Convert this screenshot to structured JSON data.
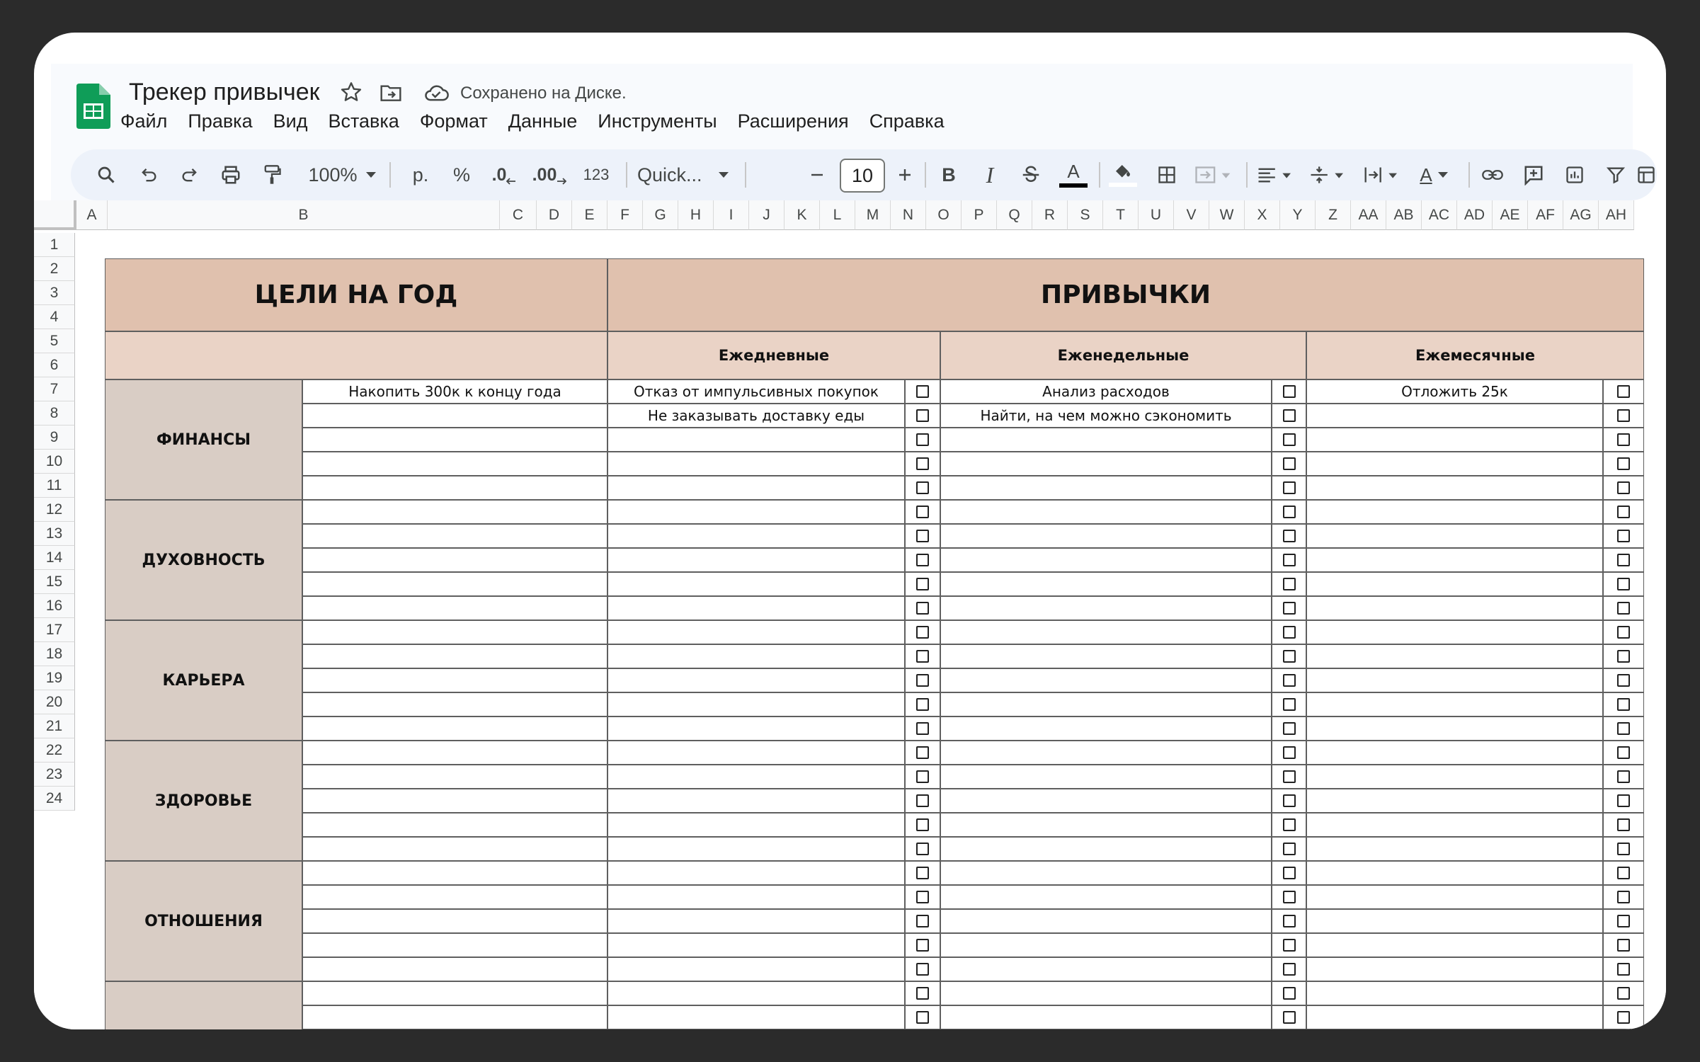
{
  "app": {
    "title": "Трекер привычек",
    "save_status": "Сохранено на Диске.",
    "menu": [
      "Файл",
      "Правка",
      "Вид",
      "Вставка",
      "Формат",
      "Данные",
      "Инструменты",
      "Расширения",
      "Справка"
    ]
  },
  "toolbar": {
    "zoom": "100%",
    "currency": "р.",
    "percent": "%",
    "decrease_decimal": ".0",
    "increase_decimal": ".00",
    "number_format": "123",
    "font": "Quick...",
    "font_size": "10",
    "bold": "B",
    "italic": "I",
    "text_color_letter": "A",
    "text_rotation_letter": "A"
  },
  "columns": [
    "A",
    "B",
    "C",
    "D",
    "E",
    "F",
    "G",
    "H",
    "I",
    "J",
    "K",
    "L",
    "M",
    "N",
    "O",
    "P",
    "Q",
    "R",
    "S",
    "T",
    "U",
    "V",
    "W",
    "X",
    "Y",
    "Z",
    "AA",
    "AB",
    "AC",
    "AD",
    "AE",
    "AF",
    "AG",
    "AH"
  ],
  "rows": [
    "1",
    "2",
    "3",
    "4",
    "5",
    "6",
    "7",
    "8",
    "9",
    "10",
    "11",
    "12",
    "13",
    "14",
    "15",
    "16",
    "17",
    "18",
    "19",
    "20",
    "21",
    "22",
    "23",
    "24"
  ],
  "sheet": {
    "goals_header": "ЦЕЛИ НА ГОД",
    "habits_header": "ПРИВЫЧКИ",
    "daily_header": "Ежедневные",
    "weekly_header": "Еженедельные",
    "monthly_header": "Ежемесячные",
    "categories": [
      "ФИНАНСЫ",
      "ДУХОВНОСТЬ",
      "КАРЬЕРА",
      "ЗДОРОВЬЕ",
      "ОТНОШЕНИЯ"
    ],
    "goals": [
      "Накопить 300к к концу года"
    ],
    "daily": [
      "Отказ от импульсивных покупок",
      "Не заказывать доставку еды"
    ],
    "weekly": [
      "Анализ расходов",
      "Найти, на чем можно сэкономить"
    ],
    "monthly": [
      "Отложить 25к"
    ]
  },
  "colors": {
    "header_fill": "#e0c1ae",
    "subheader_fill": "#ead3c6",
    "category_fill": "#d9cdc5",
    "toolbar_bg": "#edf2fa",
    "sheets_green": "#0f9d58"
  }
}
